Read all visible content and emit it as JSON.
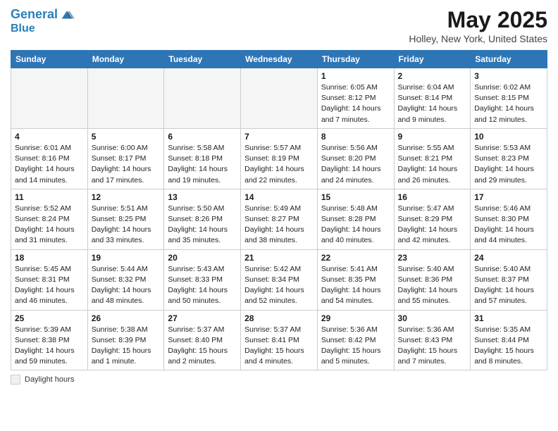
{
  "header": {
    "logo_line1": "General",
    "logo_line2": "Blue",
    "title": "May 2025",
    "subtitle": "Holley, New York, United States"
  },
  "days_of_week": [
    "Sunday",
    "Monday",
    "Tuesday",
    "Wednesday",
    "Thursday",
    "Friday",
    "Saturday"
  ],
  "weeks": [
    [
      {
        "day": "",
        "text": "",
        "empty": true
      },
      {
        "day": "",
        "text": "",
        "empty": true
      },
      {
        "day": "",
        "text": "",
        "empty": true
      },
      {
        "day": "",
        "text": "",
        "empty": true
      },
      {
        "day": "1",
        "text": "Sunrise: 6:05 AM\nSunset: 8:12 PM\nDaylight: 14 hours\nand 7 minutes."
      },
      {
        "day": "2",
        "text": "Sunrise: 6:04 AM\nSunset: 8:14 PM\nDaylight: 14 hours\nand 9 minutes."
      },
      {
        "day": "3",
        "text": "Sunrise: 6:02 AM\nSunset: 8:15 PM\nDaylight: 14 hours\nand 12 minutes."
      }
    ],
    [
      {
        "day": "4",
        "text": "Sunrise: 6:01 AM\nSunset: 8:16 PM\nDaylight: 14 hours\nand 14 minutes."
      },
      {
        "day": "5",
        "text": "Sunrise: 6:00 AM\nSunset: 8:17 PM\nDaylight: 14 hours\nand 17 minutes."
      },
      {
        "day": "6",
        "text": "Sunrise: 5:58 AM\nSunset: 8:18 PM\nDaylight: 14 hours\nand 19 minutes."
      },
      {
        "day": "7",
        "text": "Sunrise: 5:57 AM\nSunset: 8:19 PM\nDaylight: 14 hours\nand 22 minutes."
      },
      {
        "day": "8",
        "text": "Sunrise: 5:56 AM\nSunset: 8:20 PM\nDaylight: 14 hours\nand 24 minutes."
      },
      {
        "day": "9",
        "text": "Sunrise: 5:55 AM\nSunset: 8:21 PM\nDaylight: 14 hours\nand 26 minutes."
      },
      {
        "day": "10",
        "text": "Sunrise: 5:53 AM\nSunset: 8:23 PM\nDaylight: 14 hours\nand 29 minutes."
      }
    ],
    [
      {
        "day": "11",
        "text": "Sunrise: 5:52 AM\nSunset: 8:24 PM\nDaylight: 14 hours\nand 31 minutes."
      },
      {
        "day": "12",
        "text": "Sunrise: 5:51 AM\nSunset: 8:25 PM\nDaylight: 14 hours\nand 33 minutes."
      },
      {
        "day": "13",
        "text": "Sunrise: 5:50 AM\nSunset: 8:26 PM\nDaylight: 14 hours\nand 35 minutes."
      },
      {
        "day": "14",
        "text": "Sunrise: 5:49 AM\nSunset: 8:27 PM\nDaylight: 14 hours\nand 38 minutes."
      },
      {
        "day": "15",
        "text": "Sunrise: 5:48 AM\nSunset: 8:28 PM\nDaylight: 14 hours\nand 40 minutes."
      },
      {
        "day": "16",
        "text": "Sunrise: 5:47 AM\nSunset: 8:29 PM\nDaylight: 14 hours\nand 42 minutes."
      },
      {
        "day": "17",
        "text": "Sunrise: 5:46 AM\nSunset: 8:30 PM\nDaylight: 14 hours\nand 44 minutes."
      }
    ],
    [
      {
        "day": "18",
        "text": "Sunrise: 5:45 AM\nSunset: 8:31 PM\nDaylight: 14 hours\nand 46 minutes."
      },
      {
        "day": "19",
        "text": "Sunrise: 5:44 AM\nSunset: 8:32 PM\nDaylight: 14 hours\nand 48 minutes."
      },
      {
        "day": "20",
        "text": "Sunrise: 5:43 AM\nSunset: 8:33 PM\nDaylight: 14 hours\nand 50 minutes."
      },
      {
        "day": "21",
        "text": "Sunrise: 5:42 AM\nSunset: 8:34 PM\nDaylight: 14 hours\nand 52 minutes."
      },
      {
        "day": "22",
        "text": "Sunrise: 5:41 AM\nSunset: 8:35 PM\nDaylight: 14 hours\nand 54 minutes."
      },
      {
        "day": "23",
        "text": "Sunrise: 5:40 AM\nSunset: 8:36 PM\nDaylight: 14 hours\nand 55 minutes."
      },
      {
        "day": "24",
        "text": "Sunrise: 5:40 AM\nSunset: 8:37 PM\nDaylight: 14 hours\nand 57 minutes."
      }
    ],
    [
      {
        "day": "25",
        "text": "Sunrise: 5:39 AM\nSunset: 8:38 PM\nDaylight: 14 hours\nand 59 minutes."
      },
      {
        "day": "26",
        "text": "Sunrise: 5:38 AM\nSunset: 8:39 PM\nDaylight: 15 hours\nand 1 minute."
      },
      {
        "day": "27",
        "text": "Sunrise: 5:37 AM\nSunset: 8:40 PM\nDaylight: 15 hours\nand 2 minutes."
      },
      {
        "day": "28",
        "text": "Sunrise: 5:37 AM\nSunset: 8:41 PM\nDaylight: 15 hours\nand 4 minutes."
      },
      {
        "day": "29",
        "text": "Sunrise: 5:36 AM\nSunset: 8:42 PM\nDaylight: 15 hours\nand 5 minutes."
      },
      {
        "day": "30",
        "text": "Sunrise: 5:36 AM\nSunset: 8:43 PM\nDaylight: 15 hours\nand 7 minutes."
      },
      {
        "day": "31",
        "text": "Sunrise: 5:35 AM\nSunset: 8:44 PM\nDaylight: 15 hours\nand 8 minutes."
      }
    ]
  ],
  "footer": {
    "legend_label": "Daylight hours"
  }
}
